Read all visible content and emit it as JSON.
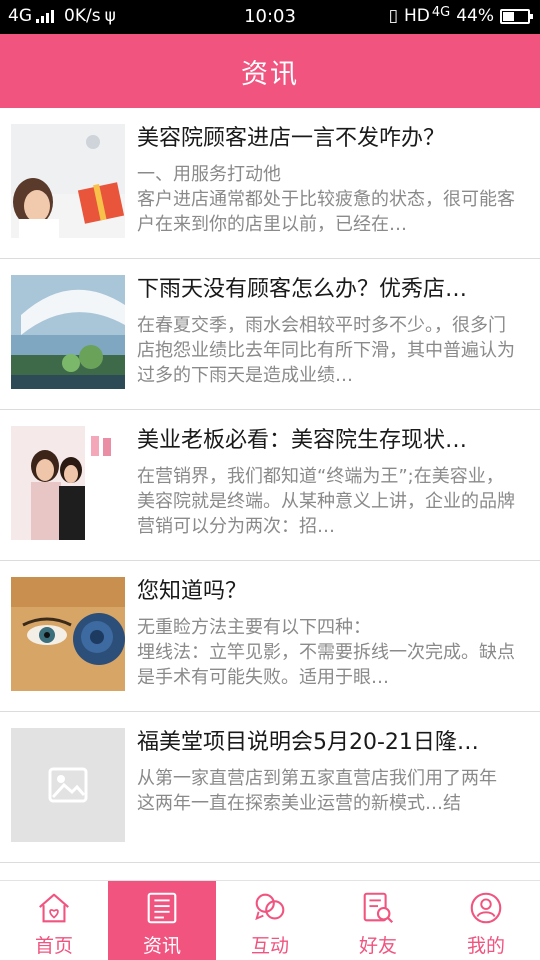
{
  "status_bar": {
    "network": "4G",
    "speed": "0K/s",
    "time": "10:03",
    "hd": "HD",
    "net2": "4G",
    "battery": "44%",
    "battery_level": 0.44
  },
  "header": {
    "title": "资讯"
  },
  "articles": [
    {
      "title": "美容院顾客进店一言不发咋办？",
      "desc": "一、用服务打动他\n客户进店通常都处于比较疲惫的状态，很可能客户在来到你的店里以前，已经在…",
      "thumb_icon": "salon-gift-photo"
    },
    {
      "title": "下雨天没有顾客怎么办？优秀店…",
      "desc": "在春夏交季，雨水会相较平时多不少。，很多门店抱怨业绩比去年同比有所下滑，其中普遍认为过多的下雨天是造成业绩…",
      "thumb_icon": "umbrella-rain-photo"
    },
    {
      "title": "美业老板必看：美容院生存现状…",
      "desc": "在营销界，我们都知道“终端为王”;在美容业，美容院就是终端。从某种意义上讲，企业的品牌营销可以分为两次：招…",
      "thumb_icon": "salon-staff-photo"
    },
    {
      "title": "您知道吗？",
      "desc": "无重睑方法主要有以下四种：\n埋线法：立竿见影，不需要拆线一次完成。缺点是手术有可能失败。适用于眼…",
      "thumb_icon": "eye-rose-photo"
    },
    {
      "title": "福美堂项目说明会5月20-21日隆…",
      "desc": "从第一家直营店到第五家直营店我们用了两年\n这两年一直在探索美业运营的新模式…结",
      "thumb_icon": "image-placeholder-icon"
    }
  ],
  "tabs": [
    {
      "label": "首页",
      "icon": "home-icon",
      "active": false
    },
    {
      "label": "资讯",
      "icon": "news-icon",
      "active": true
    },
    {
      "label": "互动",
      "icon": "chat-icon",
      "active": false
    },
    {
      "label": "好友",
      "icon": "friends-icon",
      "active": false
    },
    {
      "label": "我的",
      "icon": "profile-icon",
      "active": false
    }
  ],
  "colors": {
    "accent": "#f0547f",
    "text": "#1a1a1a",
    "muted": "#8a8a8a"
  }
}
